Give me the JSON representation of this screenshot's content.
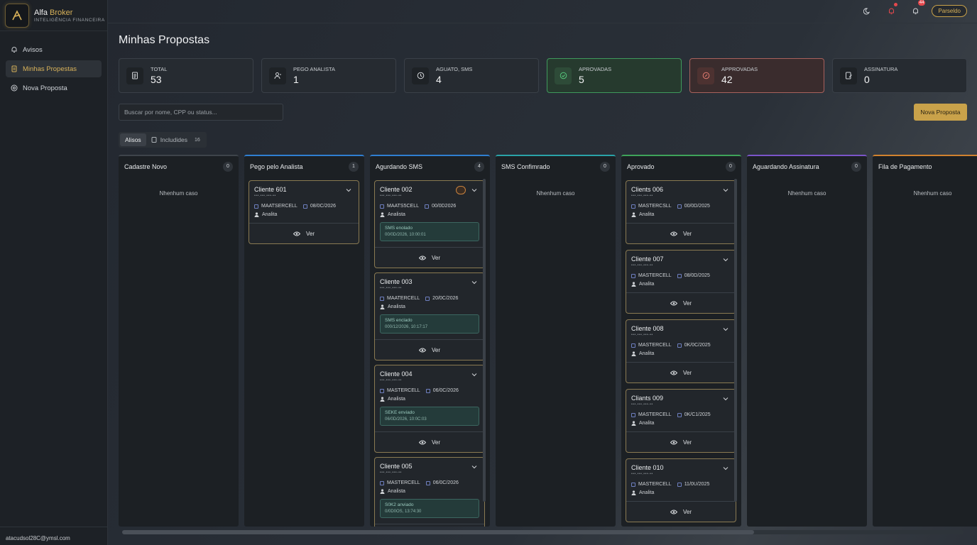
{
  "brand": {
    "name_a": "Alfa",
    "name_b": "Broker",
    "tagline": "INTELIGÊNCIA FINANCEIRA"
  },
  "sidebar": {
    "items": [
      {
        "label": "Avisos",
        "icon": "bell-icon"
      },
      {
        "label": "Minhas Propestas",
        "icon": "document-icon"
      },
      {
        "label": "Nova Proposta",
        "icon": "plus-circle-icon"
      }
    ],
    "user_email": "atacudsol28C@ymsl.com"
  },
  "topbar": {
    "notif_count": "44",
    "profile_label": "Parseldo"
  },
  "page": {
    "title": "Minhas Propostas"
  },
  "stats": [
    {
      "label": "TOTAL",
      "value": "53",
      "icon": "document-icon"
    },
    {
      "label": "PEGO ANALISTA",
      "value": "1",
      "icon": "user-icon"
    },
    {
      "label": "AGUATO, SMS",
      "value": "4",
      "icon": "clock-icon"
    },
    {
      "label": "APROVADAS",
      "value": "5",
      "icon": "check-circle-icon"
    },
    {
      "label": "APPROVADAS",
      "value": "42",
      "icon": "x-circle-icon"
    },
    {
      "label": "ASSINATURA",
      "value": "0",
      "icon": "sign-icon"
    }
  ],
  "search": {
    "placeholder": "Buscar por nome, CPP ou status..."
  },
  "new_button": "Nova Proposta",
  "tabs": [
    {
      "label": "Alisos"
    },
    {
      "label": "Includides",
      "count": "16"
    }
  ],
  "colors": {
    "gold": "#c9a24a",
    "green": "#3f9a5c",
    "red": "#a8615c"
  },
  "columns": [
    {
      "title": "Cadastre Novo",
      "count": "0",
      "accent": "#3e444b",
      "empty": "Nhenhum caso"
    },
    {
      "title": "Pego pelo Analista",
      "count": "1",
      "accent": "#2f7fd1",
      "cards": [
        {
          "name": "Cliente 601",
          "sub": "•••.•••.•••-••",
          "brand": "MAATSERCELL",
          "date": "08/0C/2026",
          "role": "Analita",
          "action": "Ver"
        }
      ]
    },
    {
      "title": "Agurdando SMS",
      "count": "4",
      "accent": "#2f7fd1",
      "cards": [
        {
          "name": "Cliente 002",
          "sub": "•••.•••.•••-••",
          "brand": "MAATS5CELL",
          "date": "00/0D2026",
          "role": "Analista",
          "sms1": "SMS enolado",
          "sms2": "00/0D/2026, 10:00:01",
          "action": "Ver"
        },
        {
          "name": "Cliente 003",
          "sub": "•••.•••.•••-••",
          "brand": "MAATERCELL",
          "date": "20/0C/2026",
          "role": "Analista",
          "sms1": "SMS enclado",
          "sms2": "000/12/2026, 10:17:17",
          "action": "Ver"
        },
        {
          "name": "Cliente 004",
          "sub": "•••.•••.•••-••",
          "brand": "MASTERCELL",
          "date": "06/0C/2026",
          "role": "Analista",
          "sms1": "SEKE enviado",
          "sms2": "06/0D/2026, 10:0C:03",
          "action": "Ver"
        },
        {
          "name": "Cliente 005",
          "sub": "•••.•••.•••-••",
          "brand": "MASTERCELL",
          "date": "06/0C/2026",
          "role": "Analista",
          "sms1": "S0K2 anviado",
          "sms2": "0/0D0OS, 13:74:30",
          "action": "Ver"
        }
      ]
    },
    {
      "title": "SMS Confimrado",
      "count": "0",
      "accent": "#2aa3a8",
      "empty": "Nhenhum caso"
    },
    {
      "title": "Aprovado",
      "count": "0",
      "accent": "#3fa35a",
      "cards": [
        {
          "name": "Clients 006",
          "sub": "•••.•••.•••-••",
          "brand": "MASTERCSLL",
          "date": "00/0D/2025",
          "role": "Analita",
          "action": "Ver"
        },
        {
          "name": "Cliente 007",
          "sub": "•••.•••.•••-••",
          "brand": "MASTERCELL",
          "date": "08/0D/2025",
          "role": "Analita",
          "action": "Ver"
        },
        {
          "name": "Cliente 008",
          "sub": "•••.•••.•••-••",
          "brand": "MASTERCELL",
          "date": "0K/0C/2025",
          "role": "Analita",
          "action": "Ver"
        },
        {
          "name": "Cliants 009",
          "sub": "•••.•••.•••-••",
          "brand": "MASTERCELL",
          "date": "0K/C1/2025",
          "role": "Analita",
          "action": "Ver"
        },
        {
          "name": "Cliente 010",
          "sub": "•••.•••.•••-••",
          "brand": "MASTERCELL",
          "date": "11/0U/2025",
          "role": "Analita",
          "action": "Ver"
        }
      ]
    },
    {
      "title": "Aguardando Assinatura",
      "count": "0",
      "accent": "#7b55c9",
      "empty": "Nhenhum caso"
    },
    {
      "title": "Fila de Pagamento",
      "count": "",
      "accent": "#d1822f",
      "empty": "Nhenhum caso"
    }
  ]
}
